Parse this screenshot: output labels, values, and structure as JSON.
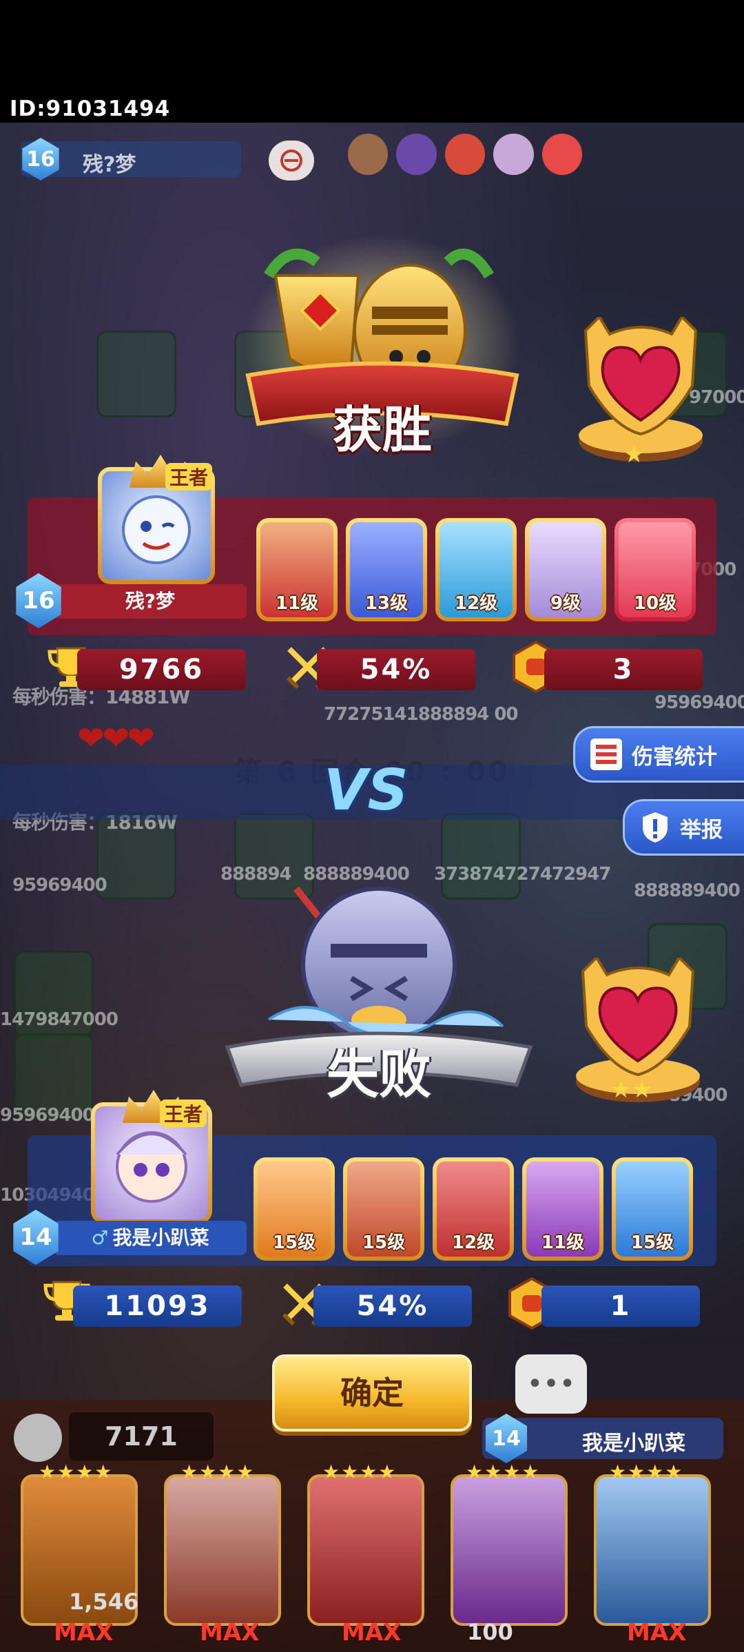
{
  "header": {
    "id_text": "ID:91031494"
  },
  "background": {
    "player_name": "残?梦",
    "player_level": "16",
    "bottom_coins": "7171",
    "bottom_value": "1,546",
    "bottom_cost": "100",
    "bottom_name": "我是小趴菜",
    "bottom_level": "14",
    "max_label": "MAX",
    "damage_per_sec_1": "每秒伤害：14881W",
    "damage_per_sec_2": "每秒伤害：1816W",
    "round_text": "第 6 回合 00 : 00",
    "bg_numbers": [
      "77275141888894 00",
      "95969400",
      "888894",
      "888889400",
      "373874727472947",
      "888889400",
      "95969400",
      "1479847000",
      "95969400",
      "10304940",
      "89400",
      "97000",
      "7000"
    ]
  },
  "victory": {
    "title": "获胜",
    "rank_badge": "王者",
    "player_level": "16",
    "player_name": "残?梦",
    "trophies": "9766",
    "win_rate": "54%",
    "fist_count": "3",
    "stars": 1,
    "heroes": [
      {
        "level": "11级",
        "color": "#c33"
      },
      {
        "level": "13级",
        "color": "#3a5ad8"
      },
      {
        "level": "12级",
        "color": "#2a9ad8"
      },
      {
        "level": "9级",
        "color": "#a58ad8"
      },
      {
        "level": "10级",
        "color": "#e23a55"
      }
    ]
  },
  "vs_label": "VS",
  "side_buttons": {
    "damage_stats": "伤害统计",
    "report": "举报"
  },
  "defeat": {
    "title": "失败",
    "rank_badge": "王者",
    "player_level": "14",
    "player_gender": "♂",
    "player_name": "我是小趴菜",
    "trophies": "11093",
    "win_rate": "54%",
    "fist_count": "1",
    "stars": 2,
    "heroes": [
      {
        "level": "15级",
        "color": "#e07a20"
      },
      {
        "level": "15级",
        "color": "#c0482a"
      },
      {
        "level": "12级",
        "color": "#c03030"
      },
      {
        "level": "11级",
        "color": "#8a3ab8"
      },
      {
        "level": "15级",
        "color": "#2a7ad8"
      }
    ]
  },
  "confirm_label": "确定",
  "colors": {
    "win_strip": "#8c1428",
    "lose_strip": "#1e3c8c",
    "gold": "#f6b92c",
    "vs": "#8fd8ff"
  }
}
